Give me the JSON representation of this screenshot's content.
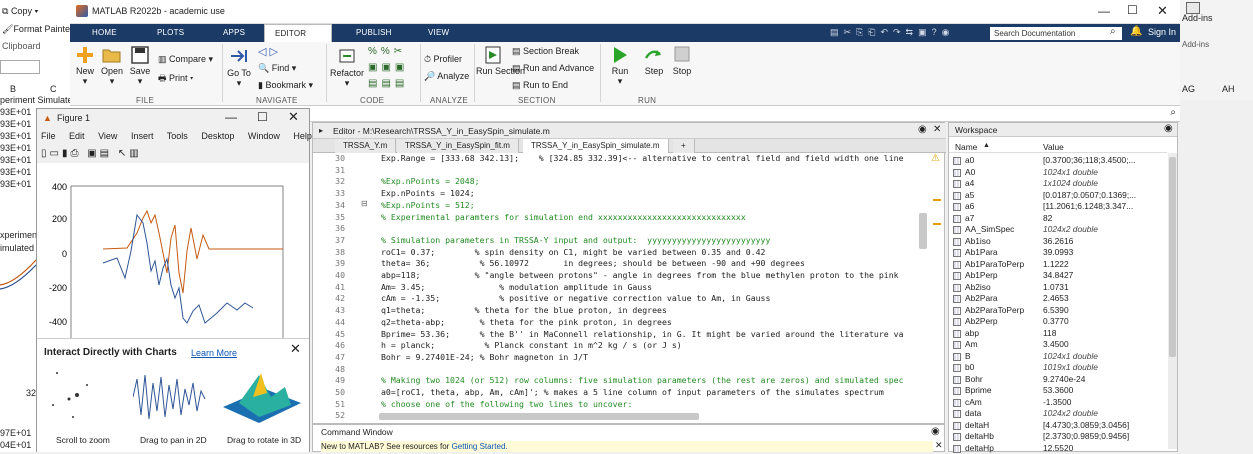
{
  "excel": {
    "clipboard_items": [
      "Copy",
      "Format Painter",
      "Clipboard"
    ],
    "col_headers": [
      "B",
      "C"
    ],
    "cells": [
      "periment Simulated",
      "93E+01",
      "93E+01",
      "93E+01",
      "93E+01",
      "93E+01",
      "93E+01",
      "93E+01"
    ],
    "side_text": [
      "xperimen",
      "imulated"
    ],
    "bottom_cells": [
      "97E+01",
      "04E+01"
    ],
    "axis_label": "32",
    "right_labels": [
      "Add-ins",
      "Add-ins"
    ],
    "right_cols": [
      "AG",
      "AH"
    ]
  },
  "app": {
    "title": "MATLAB R2022b - academic use",
    "search_placeholder": "Search Documentation",
    "sign_in": "Sign In"
  },
  "tabs": [
    "HOME",
    "PLOTS",
    "APPS",
    "EDITOR",
    "PUBLISH",
    "VIEW"
  ],
  "ribbon": {
    "file": {
      "label": "FILE",
      "new": "New",
      "open": "Open",
      "save": "Save",
      "compare": "Compare",
      "print": "Print"
    },
    "navigate": {
      "label": "NAVIGATE",
      "goto": "Go To",
      "find": "Find",
      "bookmark": "Bookmark"
    },
    "code": {
      "label": "CODE",
      "refactor": "Refactor"
    },
    "analyze": {
      "label": "ANALYZE",
      "profiler": "Profiler",
      "analyze": "Analyze"
    },
    "section": {
      "label": "SECTION",
      "run_section": "Run Section",
      "section_break": "Section Break",
      "run_advance": "Run and Advance",
      "run_end": "Run to End"
    },
    "run": {
      "label": "RUN",
      "run": "Run",
      "step": "Step",
      "stop": "Stop"
    }
  },
  "figure": {
    "title": "Figure 1",
    "menu": [
      "File",
      "Edit",
      "View",
      "Insert",
      "Tools",
      "Desktop",
      "Window",
      "Help"
    ],
    "yticks": [
      "400",
      "200",
      "0",
      "-200",
      "-400"
    ],
    "popup_title": "Interact Directly with Charts",
    "popup_link": "Learn More",
    "captions": [
      "Scroll to zoom",
      "Drag to pan in 2D",
      "Drag to rotate in 3D"
    ]
  },
  "editor": {
    "header": "Editor - M:\\Research\\TRSSA_Y_in_EasySpin_simulate.m",
    "tabs": [
      "TRSSA_Y.m",
      "TRSSA_Y_in_EasySpin_fit.m",
      "TRSSA_Y_in_EasySpin_simulate.m",
      "+"
    ],
    "lines": [
      {
        "n": "30",
        "code": "Exp.Range = [333.68 342.13];    % [324.85 332.39]<-- alternative to central field and field width one line"
      },
      {
        "n": "31",
        "code": ""
      },
      {
        "n": "32",
        "code": "%Exp.nPoints = 2048;"
      },
      {
        "n": "33",
        "code": "Exp.nPoints = 1024;"
      },
      {
        "n": "34",
        "code": "%Exp.nPoints = 512;"
      },
      {
        "n": "35",
        "code": "% Experimental paramters for simulation end xxxxxxxxxxxxxxxxxxxxxxxxxxxxxx"
      },
      {
        "n": "36",
        "code": ""
      },
      {
        "n": "37",
        "code": "% Simulation parameters in TRSSA-Y input and output:  yyyyyyyyyyyyyyyyyyyyyyyyy"
      },
      {
        "n": "38",
        "code": "roC1= 0.37;        % spin density on C1, might be varied between 0.35 and 0.42"
      },
      {
        "n": "39",
        "code": "theta= 36;          % 56.10972       in degrees; should be between -90 and +90 degrees"
      },
      {
        "n": "40",
        "code": "abp=118;           % \"angle between protons\" - angle in degrees from the blue methylen proton to the pink"
      },
      {
        "n": "41",
        "code": "Am= 3.45;               % modulation amplitude in Gauss"
      },
      {
        "n": "42",
        "code": "cAm = -1.35;            % positive or negative correction value to Am, in Gauss"
      },
      {
        "n": "43",
        "code": "q1=theta;          % theta for the blue proton, in degrees"
      },
      {
        "n": "44",
        "code": "q2=theta-abp;       % theta for the pink proton, in degrees"
      },
      {
        "n": "45",
        "code": "Bprime= 53.36;      % the B'' in MaConnell relationship, in G. It might be varied around the literature va"
      },
      {
        "n": "46",
        "code": "h = planck;          % Planck constant in m^2 kg / s (or J s)"
      },
      {
        "n": "47",
        "code": "Bohr = 9.27401E-24; % Bohr magneton in J/T"
      },
      {
        "n": "48",
        "code": ""
      },
      {
        "n": "49",
        "code": "% Making two 1024 (or 512) row columns: five simulation parameters (the rest are zeros) and simulated spec"
      },
      {
        "n": "50",
        "code": "a0=[roC1, theta, abp, Am, cAm]'; % makes a 5 line column of input parameters of the simulates spectrum"
      },
      {
        "n": "51",
        "code": "% choose one of the following two lines to uncover:"
      },
      {
        "n": "52",
        "code": ""
      }
    ]
  },
  "command_window": {
    "title": "Command Window",
    "message": "New to MATLAB? See resources for ",
    "link": "Getting Started."
  },
  "workspace": {
    "title": "Workspace",
    "col_name": "Name",
    "col_value": "Value",
    "vars": [
      {
        "name": "a0",
        "value": "[0.3700;36;118;3.4500;..."
      },
      {
        "name": "A0",
        "value": "1024x1 double"
      },
      {
        "name": "a4",
        "value": "1x1024 double"
      },
      {
        "name": "a5",
        "value": "[0.0187;0.0507;0.1369;..."
      },
      {
        "name": "a6",
        "value": "[11.2061;6.1248;3.347..."
      },
      {
        "name": "a7",
        "value": "82"
      },
      {
        "name": "AA_SimSpec",
        "value": "1024x2 double"
      },
      {
        "name": "Ab1iso",
        "value": "36.2616"
      },
      {
        "name": "Ab1Para",
        "value": "39.0993"
      },
      {
        "name": "Ab1ParaToPerp",
        "value": "1.1222"
      },
      {
        "name": "Ab1Perp",
        "value": "34.8427"
      },
      {
        "name": "Ab2iso",
        "value": "1.0731"
      },
      {
        "name": "Ab2Para",
        "value": "2.4653"
      },
      {
        "name": "Ab2ParaToPerp",
        "value": "6.5390"
      },
      {
        "name": "Ab2Perp",
        "value": "0.3770"
      },
      {
        "name": "abp",
        "value": "118"
      },
      {
        "name": "Am",
        "value": "3.4500"
      },
      {
        "name": "B",
        "value": "1024x1 double"
      },
      {
        "name": "b0",
        "value": "1019x1 double"
      },
      {
        "name": "Bohr",
        "value": "9.2740e-24"
      },
      {
        "name": "Bprime",
        "value": "53.3600"
      },
      {
        "name": "cAm",
        "value": "-1.3500"
      },
      {
        "name": "data",
        "value": "1024x2 double"
      },
      {
        "name": "deltaH",
        "value": "[4.4730;3.0859;3.0456]"
      },
      {
        "name": "deltaHb",
        "value": "[2.3730;0.9859;0.9456]"
      },
      {
        "name": "deltaHp",
        "value": "12.5520"
      }
    ]
  }
}
